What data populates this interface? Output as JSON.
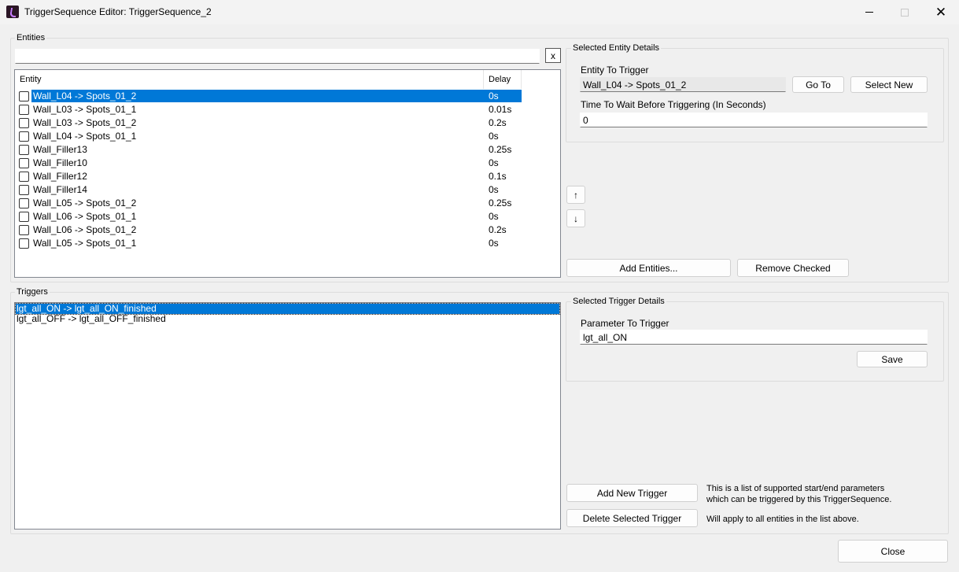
{
  "window": {
    "title": "TriggerSequence Editor: TriggerSequence_2"
  },
  "entities": {
    "group_label": "Entities",
    "filter_value": "",
    "clear_button": "x",
    "columns": [
      "Entity",
      "Delay"
    ],
    "rows": [
      {
        "name": "Wall_L04 -> Spots_01_2",
        "delay": "0s",
        "checked": false,
        "selected": true
      },
      {
        "name": "Wall_L03 -> Spots_01_1",
        "delay": "0.01s",
        "checked": false,
        "selected": false
      },
      {
        "name": "Wall_L03 -> Spots_01_2",
        "delay": "0.2s",
        "checked": false,
        "selected": false
      },
      {
        "name": "Wall_L04 -> Spots_01_1",
        "delay": "0s",
        "checked": false,
        "selected": false
      },
      {
        "name": "Wall_Filler13",
        "delay": "0.25s",
        "checked": false,
        "selected": false
      },
      {
        "name": "Wall_Filler10",
        "delay": "0s",
        "checked": false,
        "selected": false
      },
      {
        "name": "Wall_Filler12",
        "delay": "0.1s",
        "checked": false,
        "selected": false
      },
      {
        "name": "Wall_Filler14",
        "delay": "0s",
        "checked": false,
        "selected": false
      },
      {
        "name": "Wall_L05 -> Spots_01_2",
        "delay": "0.25s",
        "checked": false,
        "selected": false
      },
      {
        "name": "Wall_L06 -> Spots_01_1",
        "delay": "0s",
        "checked": false,
        "selected": false
      },
      {
        "name": "Wall_L06 -> Spots_01_2",
        "delay": "0.2s",
        "checked": false,
        "selected": false
      },
      {
        "name": "Wall_L05 -> Spots_01_1",
        "delay": "0s",
        "checked": false,
        "selected": false
      }
    ],
    "move_up": "↑",
    "move_down": "↓",
    "add_button": "Add Entities...",
    "remove_button": "Remove Checked"
  },
  "entity_details": {
    "group_label": "Selected Entity Details",
    "entity_label": "Entity To Trigger",
    "entity_value": "Wall_L04 -> Spots_01_2",
    "goto_button": "Go To",
    "select_new_button": "Select New",
    "wait_label": "Time To Wait Before Triggering (In Seconds)",
    "wait_value": "0"
  },
  "triggers": {
    "group_label": "Triggers",
    "items": [
      {
        "label": "lgt_all_ON -> lgt_all_ON_finished",
        "selected": true
      },
      {
        "label": "lgt_all_OFF -> lgt_all_OFF_finished",
        "selected": false
      }
    ],
    "add_button": "Add New Trigger",
    "delete_button": "Delete Selected Trigger",
    "note_1": "This is a list of supported start/end parameters which can be triggered by this TriggerSequence.",
    "note_2": "Will apply to all entities in the list above."
  },
  "trigger_details": {
    "group_label": "Selected Trigger Details",
    "param_label": "Parameter To Trigger",
    "param_value": "lgt_all_ON",
    "save_button": "Save"
  },
  "footer": {
    "close_button": "Close"
  },
  "colors": {
    "selection": "#0078d7",
    "window_bg": "#f0f0f0"
  }
}
